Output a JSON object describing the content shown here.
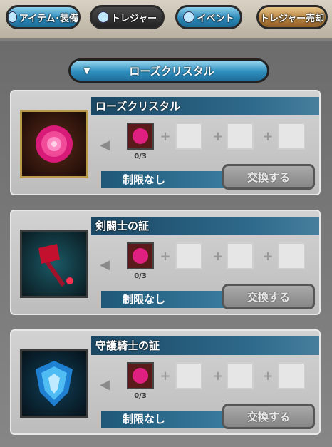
{
  "tabs": [
    {
      "label": "アイテム･装備",
      "icon": "potion-icon"
    },
    {
      "label": "トレジャー",
      "icon": "treasure-icon"
    },
    {
      "label": "イベント",
      "icon": "event-icon"
    },
    {
      "label": "トレジャー売却"
    }
  ],
  "filter": {
    "arrow": "▼",
    "label": "ローズクリスタル"
  },
  "cards": [
    {
      "title": "ローズクリスタル",
      "icon": "rose-icon",
      "required_count": "0/3",
      "limit": "制限なし",
      "exchange_label": "交換する"
    },
    {
      "title": "剣闘士の証",
      "icon": "axe-icon",
      "required_count": "0/3",
      "limit": "制限なし",
      "exchange_label": "交換する"
    },
    {
      "title": "守護騎士の証",
      "icon": "blue-shield-icon",
      "required_count": "0/3",
      "limit": "制限なし",
      "exchange_label": "交換する"
    }
  ],
  "colors": {
    "tab_active": "#2a8ab8",
    "tab_sell": "#b88442",
    "panel": "#7f7f7f",
    "rose": "#e0207a",
    "blue": "#2a9de0"
  }
}
